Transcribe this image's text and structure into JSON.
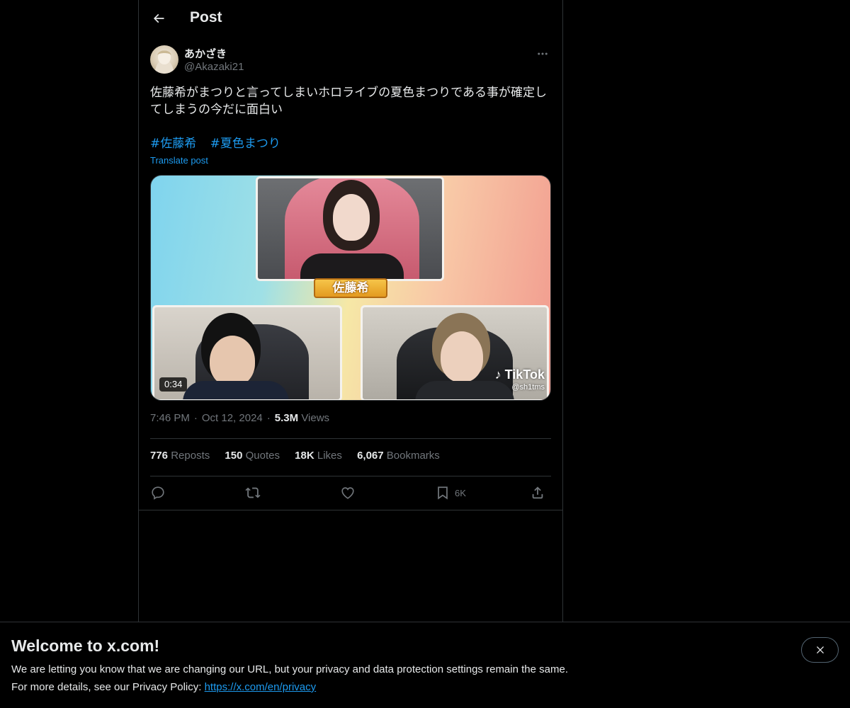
{
  "header": {
    "title": "Post"
  },
  "author": {
    "display_name": "あかざき",
    "handle": "@Akazaki21"
  },
  "post": {
    "text": "佐藤希がまつりと言ってしまいホロライブの夏色まつりである事が確定してしまうの今だに面白い",
    "hashtags": [
      "#佐藤希",
      "#夏色まつり"
    ],
    "translate_label": "Translate post"
  },
  "media": {
    "name_plate": "佐藤希",
    "duration": "0:34",
    "watermark_brand": "TikTok",
    "watermark_handle": "@sh1tms"
  },
  "meta": {
    "time": "7:46 PM",
    "date": "Oct 12, 2024",
    "views_count": "5.3M",
    "views_label": "Views"
  },
  "stats": [
    {
      "count": "776",
      "label": "Reposts"
    },
    {
      "count": "150",
      "label": "Quotes"
    },
    {
      "count": "18K",
      "label": "Likes"
    },
    {
      "count": "6,067",
      "label": "Bookmarks"
    }
  ],
  "actions": {
    "bookmark_count": "6K"
  },
  "banner": {
    "title": "Welcome to x.com!",
    "line1": "We are letting you know that we are changing our URL, but your privacy and data protection settings remain the same.",
    "line2_prefix": "For more details, see our Privacy Policy: ",
    "link": "https://x.com/en/privacy"
  },
  "colors": {
    "accent": "#1d9bf0",
    "muted": "#71767b",
    "text": "#e7e9ea",
    "border": "#2f3336",
    "background": "#000000"
  }
}
